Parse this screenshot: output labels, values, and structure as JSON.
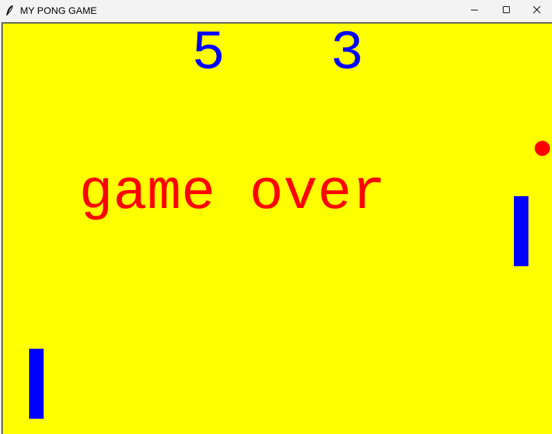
{
  "window": {
    "title": "MY PONG GAME",
    "icons": {
      "app": "feather-icon",
      "minimize": "minimize-icon",
      "maximize": "maximize-icon",
      "close": "close-icon"
    }
  },
  "game": {
    "score_left": "5",
    "score_right": "3",
    "message": "game over",
    "colors": {
      "background": "#ffff00",
      "score": "#0000ff",
      "message": "#ff0000",
      "paddle": "#0000ff",
      "ball": "#ff0000"
    }
  }
}
